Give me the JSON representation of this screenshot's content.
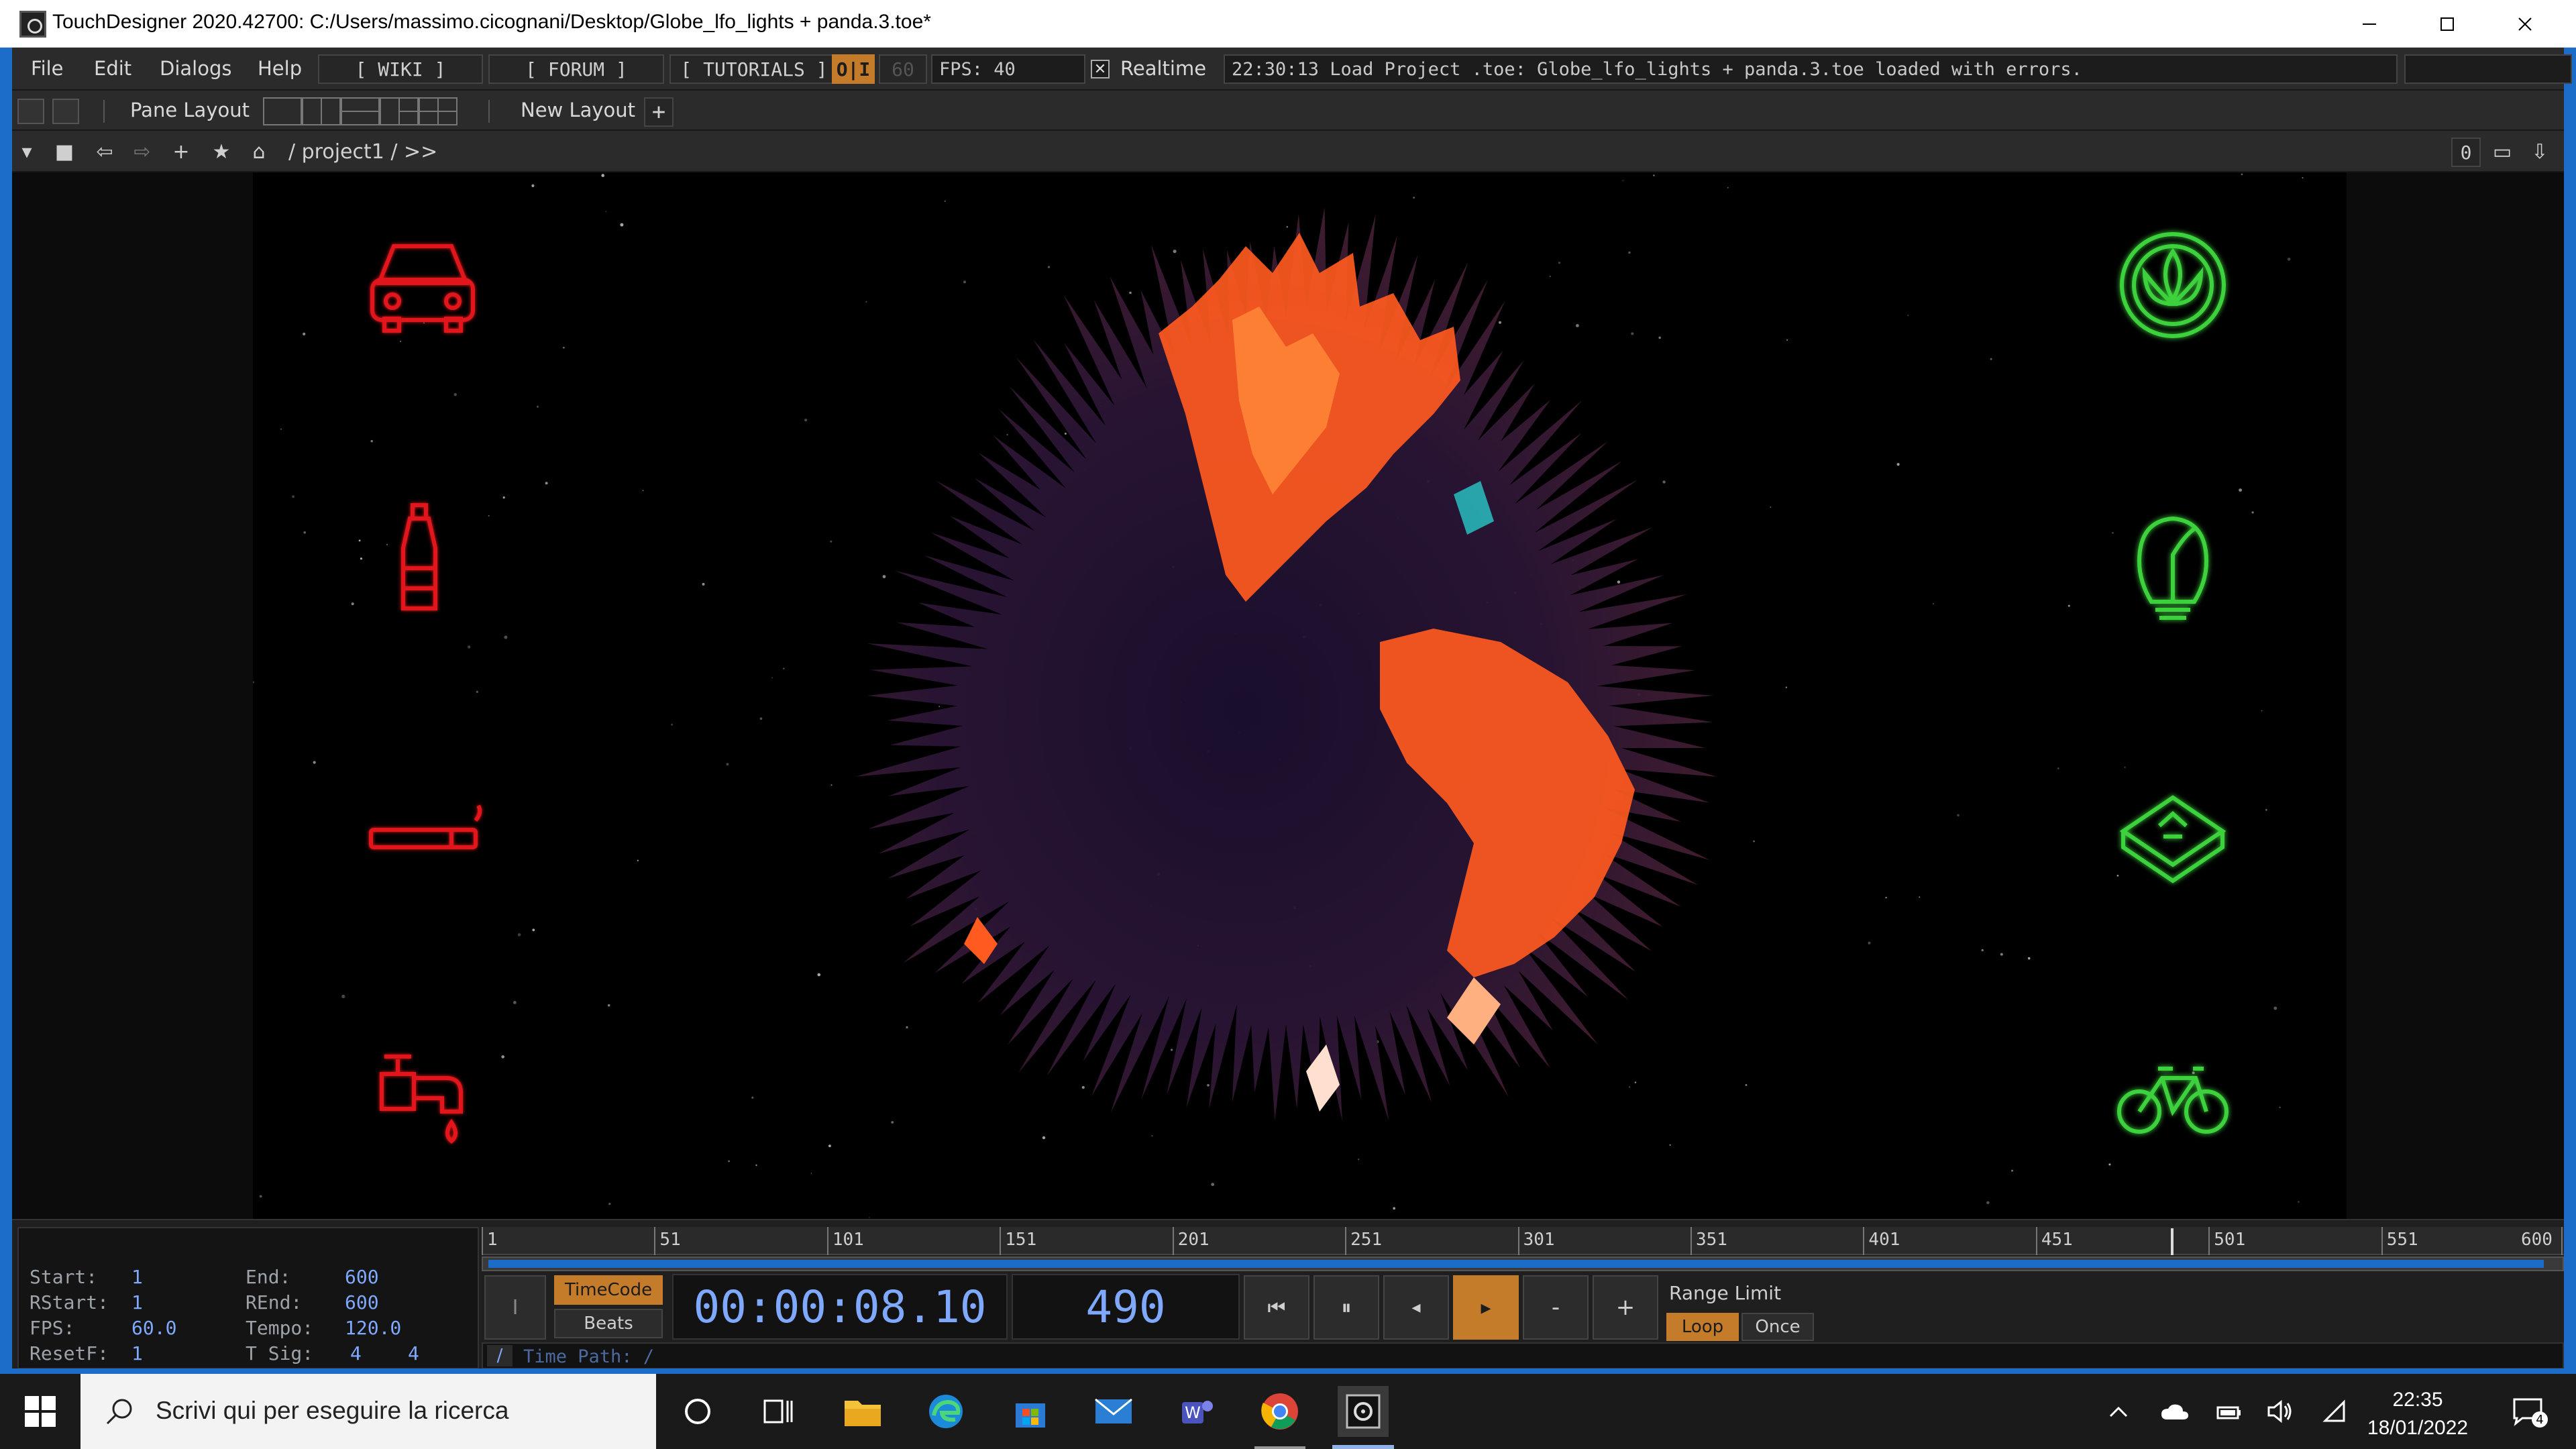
{
  "window": {
    "title": "TouchDesigner 2020.42700: C:/Users/massimo.cicognani/Desktop/Globe_lfo_lights + panda.3.toe*",
    "controls": [
      "minimize",
      "maximize",
      "close"
    ]
  },
  "menubar": {
    "items": [
      "File",
      "Edit",
      "Dialogs",
      "Help"
    ],
    "wiki": "[ WIKI ]",
    "forum": "[ FORUM ]",
    "tutorials": "[ TUTORIALS ]",
    "oi": "O|I",
    "fps_target": "60",
    "fps": "FPS: 40",
    "realtime_label": "Realtime",
    "realtime_checked": true,
    "message": "22:30:13 Load Project .toe: Globe_lfo_lights + panda.3.toe loaded with errors."
  },
  "panebar": {
    "pane_layout": "Pane Layout",
    "new_layout": "New Layout",
    "add": "+"
  },
  "pathbar": {
    "path": "/ project1 / >>",
    "counter": "0"
  },
  "render": {
    "left_icons": [
      {
        "name": "car-icon",
        "color": "#e0141b"
      },
      {
        "name": "bottle-icon",
        "color": "#e0141b"
      },
      {
        "name": "cigarette-icon",
        "color": "#e0141b"
      },
      {
        "name": "faucet-icon",
        "color": "#e0141b"
      }
    ],
    "right_icons": [
      {
        "name": "lotus-icon",
        "color": "#3cd23c"
      },
      {
        "name": "lightbulb-leaf-icon",
        "color": "#3cd23c"
      },
      {
        "name": "recycle-bin-icon",
        "color": "#3cd23c"
      },
      {
        "name": "bicycle-icon",
        "color": "#3cd23c"
      }
    ],
    "globe_colors": [
      "#3a1d3e",
      "#ff5a1f",
      "#ff8a3a"
    ]
  },
  "timeline": {
    "info": {
      "start_label": "Start:",
      "start": "1",
      "rstart_label": "RStart:",
      "rstart": "1",
      "fps_label": "FPS:",
      "fps": "60.0",
      "resetf_label": "ResetF:",
      "resetf": "1",
      "end_label": "End:",
      "end": "600",
      "rend_label": "REnd:",
      "rend": "600",
      "tempo_label": "Tempo:",
      "tempo": "120.0",
      "tsig_label": "T Sig:",
      "tsig_a": "4",
      "tsig_b": "4"
    },
    "ruler_ticks": [
      "1",
      "51",
      "101",
      "151",
      "201",
      "251",
      "301",
      "351",
      "401",
      "451",
      "501",
      "551",
      "600"
    ],
    "current_frame": 490,
    "frame_range": [
      1,
      600
    ],
    "timecode_label": "TimeCode",
    "beats_label": "Beats",
    "timecode": "00:00:08.10",
    "frame": "490",
    "range_limit": "Range Limit",
    "loop": "Loop",
    "once": "Once",
    "time_path": "Time Path: /",
    "time_path_slash": "/"
  },
  "taskbar": {
    "search_placeholder": "Scrivi qui per eseguire la ricerca",
    "apps": [
      "task-view",
      "file-explorer",
      "edge",
      "store",
      "mail",
      "teams",
      "chrome",
      "touchdesigner"
    ],
    "time": "22:35",
    "date": "18/01/2022",
    "notification_count": "4"
  }
}
